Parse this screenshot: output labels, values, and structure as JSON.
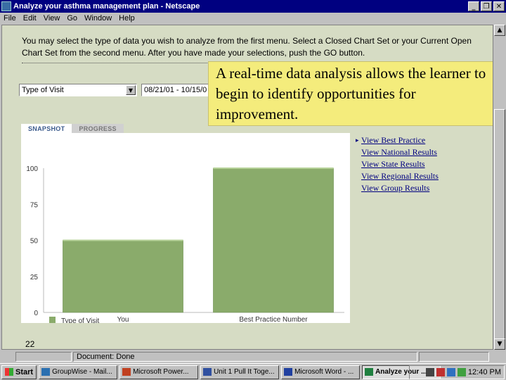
{
  "window": {
    "title": "Analyze your asthma management plan - Netscape"
  },
  "menu": [
    "File",
    "Edit",
    "View",
    "Go",
    "Window",
    "Help"
  ],
  "instructions": "You may select the type of data you wish to analyze from the first menu. Select a Closed Chart Set or your Current Open Chart Set from the second menu. After you have made your selections, push the GO button.",
  "selects": {
    "type_value": "Type of Visit",
    "date_value": "08/21/01 - 10/15/0"
  },
  "callout": "A real-time data analysis allows the learner to begin to identify opportunities for improvement.",
  "tabs": {
    "snapshot": "SNAPSHOT",
    "progress": "PROGRESS"
  },
  "links": [
    "View Best Practice",
    "View National Results",
    "View State Results",
    "View Regional Results",
    "View Group Results"
  ],
  "chart_data": {
    "type": "bar",
    "categories": [
      "You",
      "Best Practice Number"
    ],
    "series": [
      {
        "name": "Type of Visit",
        "values": [
          50,
          100
        ]
      }
    ],
    "yticks": [
      0,
      25,
      50,
      75,
      100
    ],
    "ylim": [
      0,
      100
    ],
    "bar_color": "#8aab6b",
    "legend": "bottom-left",
    "grid": false
  },
  "status": {
    "text": "Document: Done",
    "slide_number": "22"
  },
  "taskbar": {
    "start": "Start",
    "items": [
      {
        "label": "GroupWise - Mail...",
        "icon_color": "#2a6fb0"
      },
      {
        "label": "Microsoft Power...",
        "icon_color": "#c04020"
      },
      {
        "label": "Unit 1 Pull It Toge...",
        "icon_color": "#3050a0"
      },
      {
        "label": "Microsoft Word - ...",
        "icon_color": "#2040a0"
      },
      {
        "label": "Analyze your ...",
        "icon_color": "#208040"
      }
    ],
    "clock": "12:40 PM"
  }
}
